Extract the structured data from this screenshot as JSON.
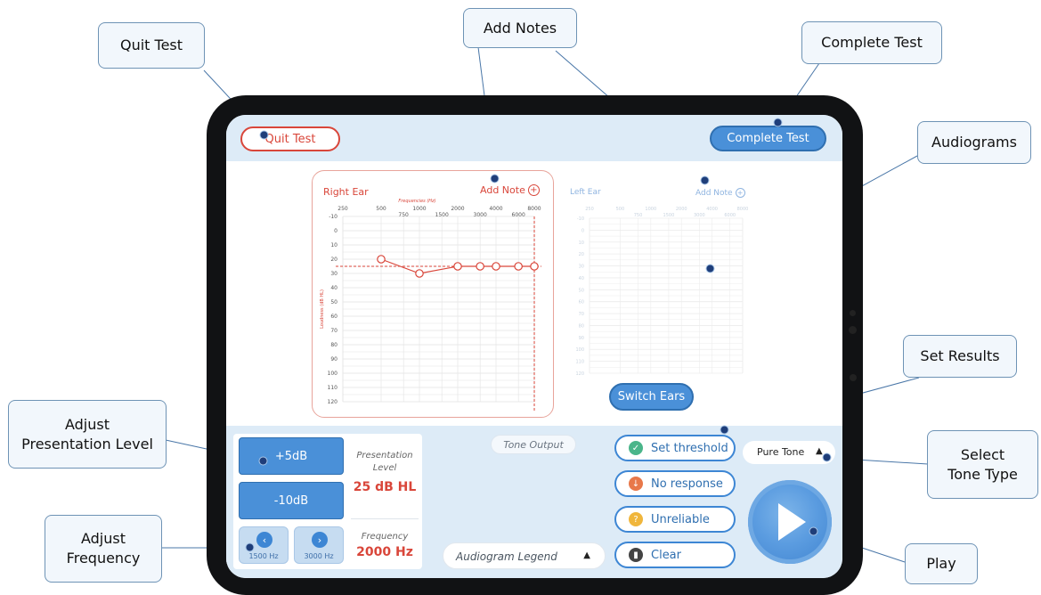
{
  "callouts": {
    "quit_test": "Quit Test",
    "add_notes": "Add Notes",
    "complete_test": "Complete Test",
    "audiograms": "Audiograms",
    "set_results": "Set Results",
    "adjust_presentation_level_line1": "Adjust",
    "adjust_presentation_level_line2": "Presentation Level",
    "select_tone_type_line1": "Select",
    "select_tone_type_line2": "Tone Type",
    "adjust_frequency_line1": "Adjust",
    "adjust_frequency_line2": "Frequency",
    "play": "Play"
  },
  "app": {
    "quit_button": "Quit Test",
    "complete_button": "Complete Test",
    "right_ear": {
      "title": "Right Ear",
      "add_note": "Add Note",
      "axis_title_top": "Frequencies (Hz)",
      "axis_title_left": "Loudness (dB HL)",
      "freq_top": [
        "250",
        "500",
        "1000",
        "2000",
        "4000",
        "8000"
      ],
      "freq_bottom": [
        "750",
        "1500",
        "3000",
        "6000"
      ],
      "db_levels": [
        "-10",
        "0",
        "10",
        "20",
        "30",
        "40",
        "50",
        "60",
        "70",
        "80",
        "90",
        "100",
        "110",
        "120"
      ],
      "color": "#d9463a"
    },
    "left_ear": {
      "title": "Left Ear",
      "add_note": "Add Note",
      "freq_top": [
        "250",
        "500",
        "1000",
        "2000",
        "4000",
        "8000"
      ],
      "freq_bottom": [
        "750",
        "1500",
        "3000",
        "6000"
      ],
      "db_levels": [
        "-10",
        "0",
        "10",
        "20",
        "30",
        "40",
        "50",
        "60",
        "70",
        "80",
        "90",
        "100",
        "110",
        "120"
      ],
      "color": "#8fb4e0"
    },
    "switch_ears": "Switch Ears",
    "level": {
      "plus_button": "+5dB",
      "minus_button": "-10dB",
      "presentation_label_line1": "Presentation",
      "presentation_label_line2": "Level",
      "presentation_value": "25 dB HL",
      "frequency_label": "Frequency",
      "frequency_value": "2000 Hz",
      "prev_frequency": "1500 Hz",
      "next_frequency": "3000 Hz"
    },
    "tone_output": "Tone Output",
    "audiogram_legend": "Audiogram Legend",
    "results": {
      "set_threshold": "Set threshold",
      "no_response": "No response",
      "unreliable": "Unreliable",
      "clear": "Clear"
    },
    "tone_type": "Pure Tone",
    "icons": {
      "set_threshold": "check-circle-icon",
      "no_response": "arrow-down-circle-icon",
      "unreliable": "question-circle-icon",
      "clear": "trash-icon",
      "play": "play-icon"
    },
    "colors": {
      "accent_blue": "#4a90d8",
      "danger_red": "#d9463a",
      "success_green": "#4ab58a",
      "warn_orange": "#e8784a",
      "warn_yellow": "#f0b63c",
      "panel_bg": "#ddebf7"
    }
  },
  "chart_data": {
    "type": "line",
    "title": "Right Ear",
    "xlabel": "Frequencies (Hz)",
    "ylabel": "Loudness (dB HL)",
    "x": [
      500,
      1000,
      2000,
      3000,
      4000,
      6000,
      8000
    ],
    "series": [
      {
        "values": [
          20,
          30,
          25,
          25,
          25,
          25,
          25
        ]
      }
    ],
    "reference_line_db": 25,
    "current_frequency_hz": 8000,
    "ylim": [
      -10,
      120
    ],
    "y_reversed": true,
    "grid": true
  }
}
